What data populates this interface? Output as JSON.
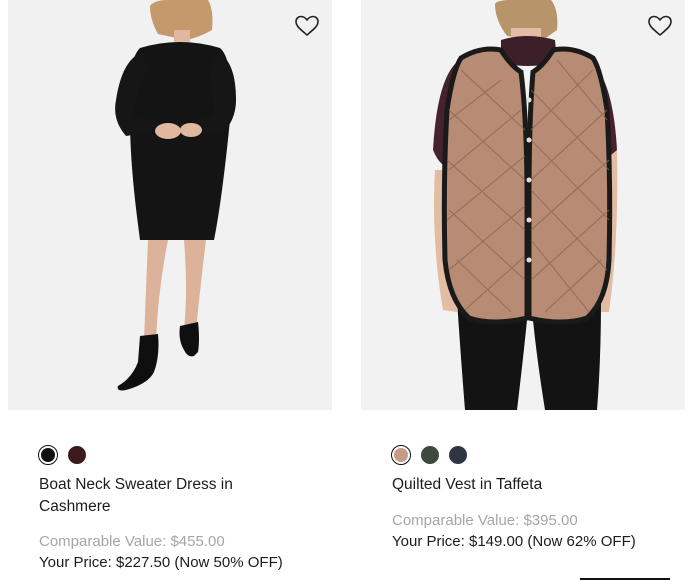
{
  "products": [
    {
      "name": "Boat Neck Sweater Dress in Cashmere",
      "swatches": [
        {
          "color": "#111111",
          "selected": true
        },
        {
          "color": "#3a1a1c",
          "selected": false
        }
      ],
      "comparable": "Comparable Value: $455.00",
      "price": "Your Price: $227.50 (Now 50% OFF)",
      "wishlist_icon": "heart-outline-icon"
    },
    {
      "name": "Quilted Vest in Taffeta",
      "swatches": [
        {
          "color": "#c69c86",
          "selected": true
        },
        {
          "color": "#3c4a3e",
          "selected": false
        },
        {
          "color": "#2f3641",
          "selected": false
        }
      ],
      "comparable": "Comparable Value: $395.00",
      "price": "Your Price: $149.00 (Now 62% OFF)",
      "wishlist_icon": "heart-outline-icon"
    }
  ]
}
